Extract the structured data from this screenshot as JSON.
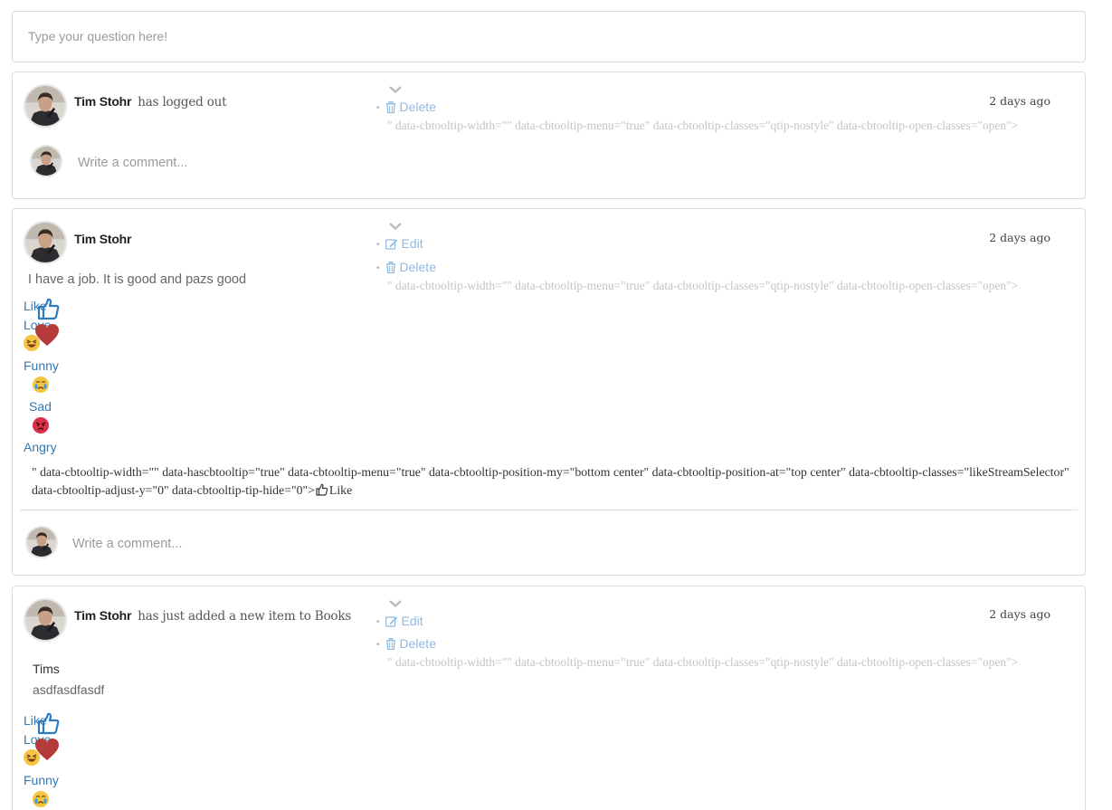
{
  "question_box": {
    "placeholder": "Type your question here!"
  },
  "menu": {
    "edit_label": "Edit",
    "delete_label": "Delete",
    "leaked_attrs": "\" data-cbtooltip-width=\"\" data-cbtooltip-menu=\"true\" data-cbtooltip-classes=\"qtip-nostyle\" data-cbtooltip-open-classes=\"open\">"
  },
  "comment": {
    "placeholder": "Write a comment..."
  },
  "reactions": {
    "like": "Like",
    "love": "Love",
    "funny": "Funny",
    "sad": "Sad",
    "angry": "Angry"
  },
  "like_leak": {
    "text": "\" data-cbtooltip-width=\"\" data-hascbtooltip=\"true\" data-cbtooltip-menu=\"true\" data-cbtooltip-position-my=\"bottom center\" data-cbtooltip-position-at=\"top center\" data-cbtooltip-classes=\"likeStreamSelector\" data-cbtooltip-adjust-y=\"0\" data-cbtooltip-tip-hide=\"0\">",
    "like_label": "Like"
  },
  "posts": [
    {
      "author": "Tim Stohr",
      "action": "has logged out",
      "time": "2 days ago"
    },
    {
      "author": "Tim Stohr",
      "action": "",
      "time": "2 days ago",
      "text": "I have a job. It is good and pazs good"
    },
    {
      "author": "Tim Stohr",
      "action": "has just added a new item to Books",
      "time": "2 days ago",
      "item_title": "Tims",
      "item_desc": "asdfasdfasdf"
    }
  ],
  "colors": {
    "link": "#3478b4",
    "menu_link": "#8fb9e0",
    "love": "#b53b3b"
  }
}
